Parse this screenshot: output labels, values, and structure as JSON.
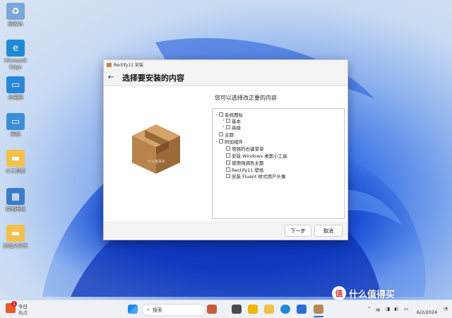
{
  "desktop_icons": [
    {
      "name": "recycle-bin-icon",
      "label": "回收站",
      "glyph": "♻",
      "color": "#7aa6d8"
    },
    {
      "name": "edge-icon",
      "label": "Microsoft Edge",
      "glyph": "e",
      "color": "#1f8ad6"
    },
    {
      "name": "this-pc-icon",
      "label": "此电脑",
      "glyph": "▭",
      "color": "#2a86d8"
    },
    {
      "name": "network-icon",
      "label": "网络",
      "glyph": "▭",
      "color": "#3a8fd8"
    },
    {
      "name": "folder-icon",
      "label": "小工具集",
      "glyph": "▬",
      "color": "#f2c14b"
    },
    {
      "name": "control-panel-icon",
      "label": "控制面板",
      "glyph": "▦",
      "color": "#3b7cc9"
    },
    {
      "name": "new-folder-icon",
      "label": "新建文件夹",
      "glyph": "▬",
      "color": "#f2c14b"
    }
  ],
  "dialog": {
    "window_title": "Rectify11 安装",
    "heading": "选择要安装的内容",
    "prompt": "您可以选择改正要的内容",
    "tree": [
      {
        "label": "系统图标",
        "expander": "⌄"
      },
      {
        "label": "基本",
        "expander": "›"
      },
      {
        "label": "高级",
        "expander": "›"
      },
      {
        "label": "主题",
        "expander": ""
      },
      {
        "label": "附加组件",
        "expander": "⌄"
      },
      {
        "label": "增强的右键菜单",
        "expander": ""
      },
      {
        "label": "安装 Windows 桌面小工具",
        "expander": ""
      },
      {
        "label": "使用强调色主题",
        "expander": ""
      },
      {
        "label": "Rectify11 壁纸",
        "expander": ""
      },
      {
        "label": "安装 Fluent 样式用户头像",
        "expander": ""
      }
    ],
    "watermark": "什么值得买",
    "next_label": "下一步",
    "cancel_label": "取消"
  },
  "taskbar": {
    "news_badge": "1",
    "news_title": "今日",
    "news_sub": "热点",
    "search_placeholder": "搜索",
    "time": "",
    "date": "6/2/2024"
  },
  "brand": {
    "circle": "值",
    "text": "什么值得买"
  }
}
